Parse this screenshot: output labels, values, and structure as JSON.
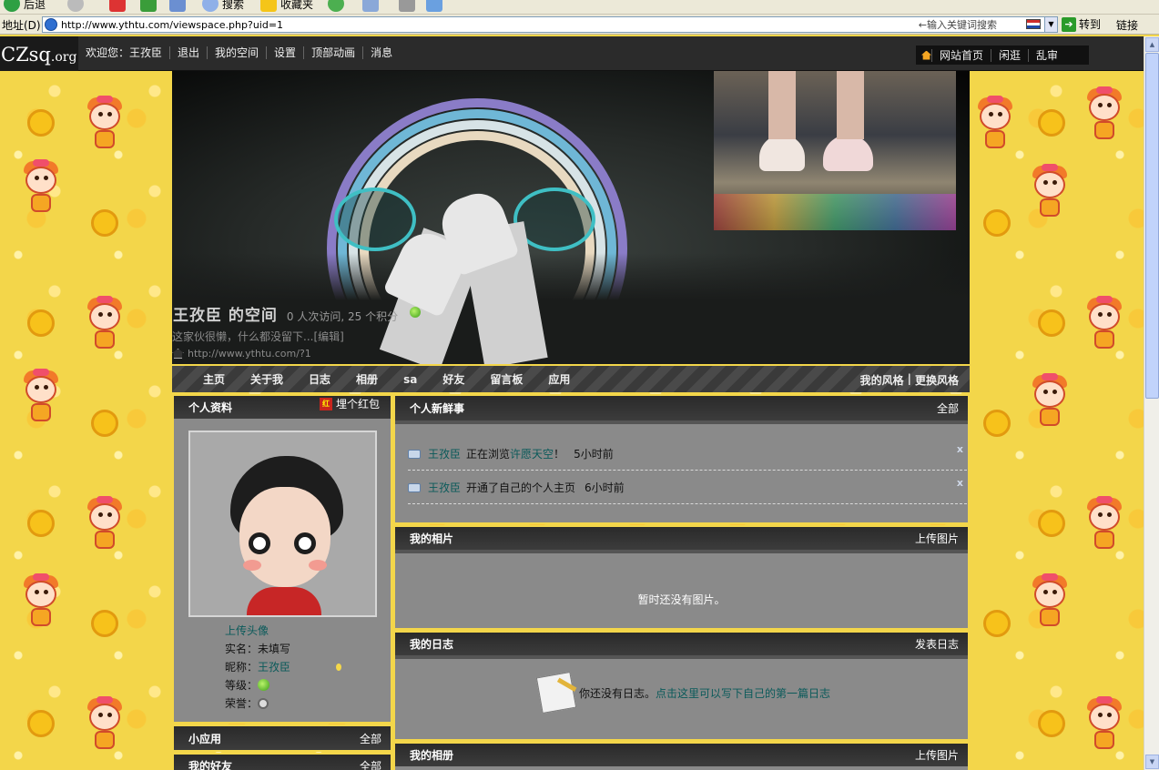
{
  "browser": {
    "toolbar": {
      "back_label": "后退",
      "search_label": "搜索",
      "favorites_label": "收藏夹"
    },
    "address_label": "地址(D)",
    "url": "http://www.ythtu.com/viewspace.php?uid=1",
    "search_placeholder": "←输入关键词搜索",
    "go_label": "转到",
    "links_label": "链接"
  },
  "site": {
    "logo_main": "CZsq",
    "logo_suffix": ".org",
    "top_nav": [
      "欢迎您：王孜臣",
      "退出",
      "我的空间",
      "设置",
      "顶部动画",
      "消息"
    ],
    "top_right": [
      "网站首页",
      "闲逛",
      "乱审"
    ]
  },
  "banner": {
    "owner_title": "王孜臣  的空间",
    "stats": "0 人次访问, 25 个积分",
    "description": "这家伙很懒，什么都没留下...[编辑]",
    "space_url": "http://www.ythtu.com/?1"
  },
  "nav": {
    "items": [
      "主页",
      "关于我",
      "日志",
      "相册",
      "sa",
      "好友",
      "留言板",
      "应用"
    ],
    "my_style": "我的风格",
    "separator": "|",
    "change_style": "更换风格"
  },
  "profile": {
    "title": "个人资料",
    "hongbao_icon": "红",
    "hongbao_label": "埋个红包",
    "upload_avatar": "上传头像",
    "realname_label": "实名：",
    "realname_value": "未填写",
    "nickname_label": "昵称：",
    "nickname_value": "王孜臣",
    "level_label": "等级：",
    "honor_label": "荣誉："
  },
  "feed": {
    "title": "个人新鲜事",
    "action": "全部",
    "items": [
      {
        "who": "王孜臣",
        "text": "正在浏览",
        "place": "许愿天空",
        "suffix": "！",
        "time": "5小时前"
      },
      {
        "who": "王孜臣",
        "text": "开通了自己的个人主页",
        "place": "",
        "suffix": "",
        "time": "6小时前"
      }
    ],
    "close_symbol": "x"
  },
  "photos": {
    "title": "我的相片",
    "action": "上传图片",
    "empty": "暂时还没有图片。"
  },
  "blog": {
    "title": "我的日志",
    "action": "发表日志",
    "empty": "你还没有日志。",
    "empty_link": "点击这里可以写下自己的第一篇日志"
  },
  "apps": {
    "title": "小应用",
    "action": "全部"
  },
  "friends": {
    "title": "我的好友",
    "action": "全部"
  },
  "albums": {
    "title": "我的相册",
    "action": "上传图片"
  }
}
